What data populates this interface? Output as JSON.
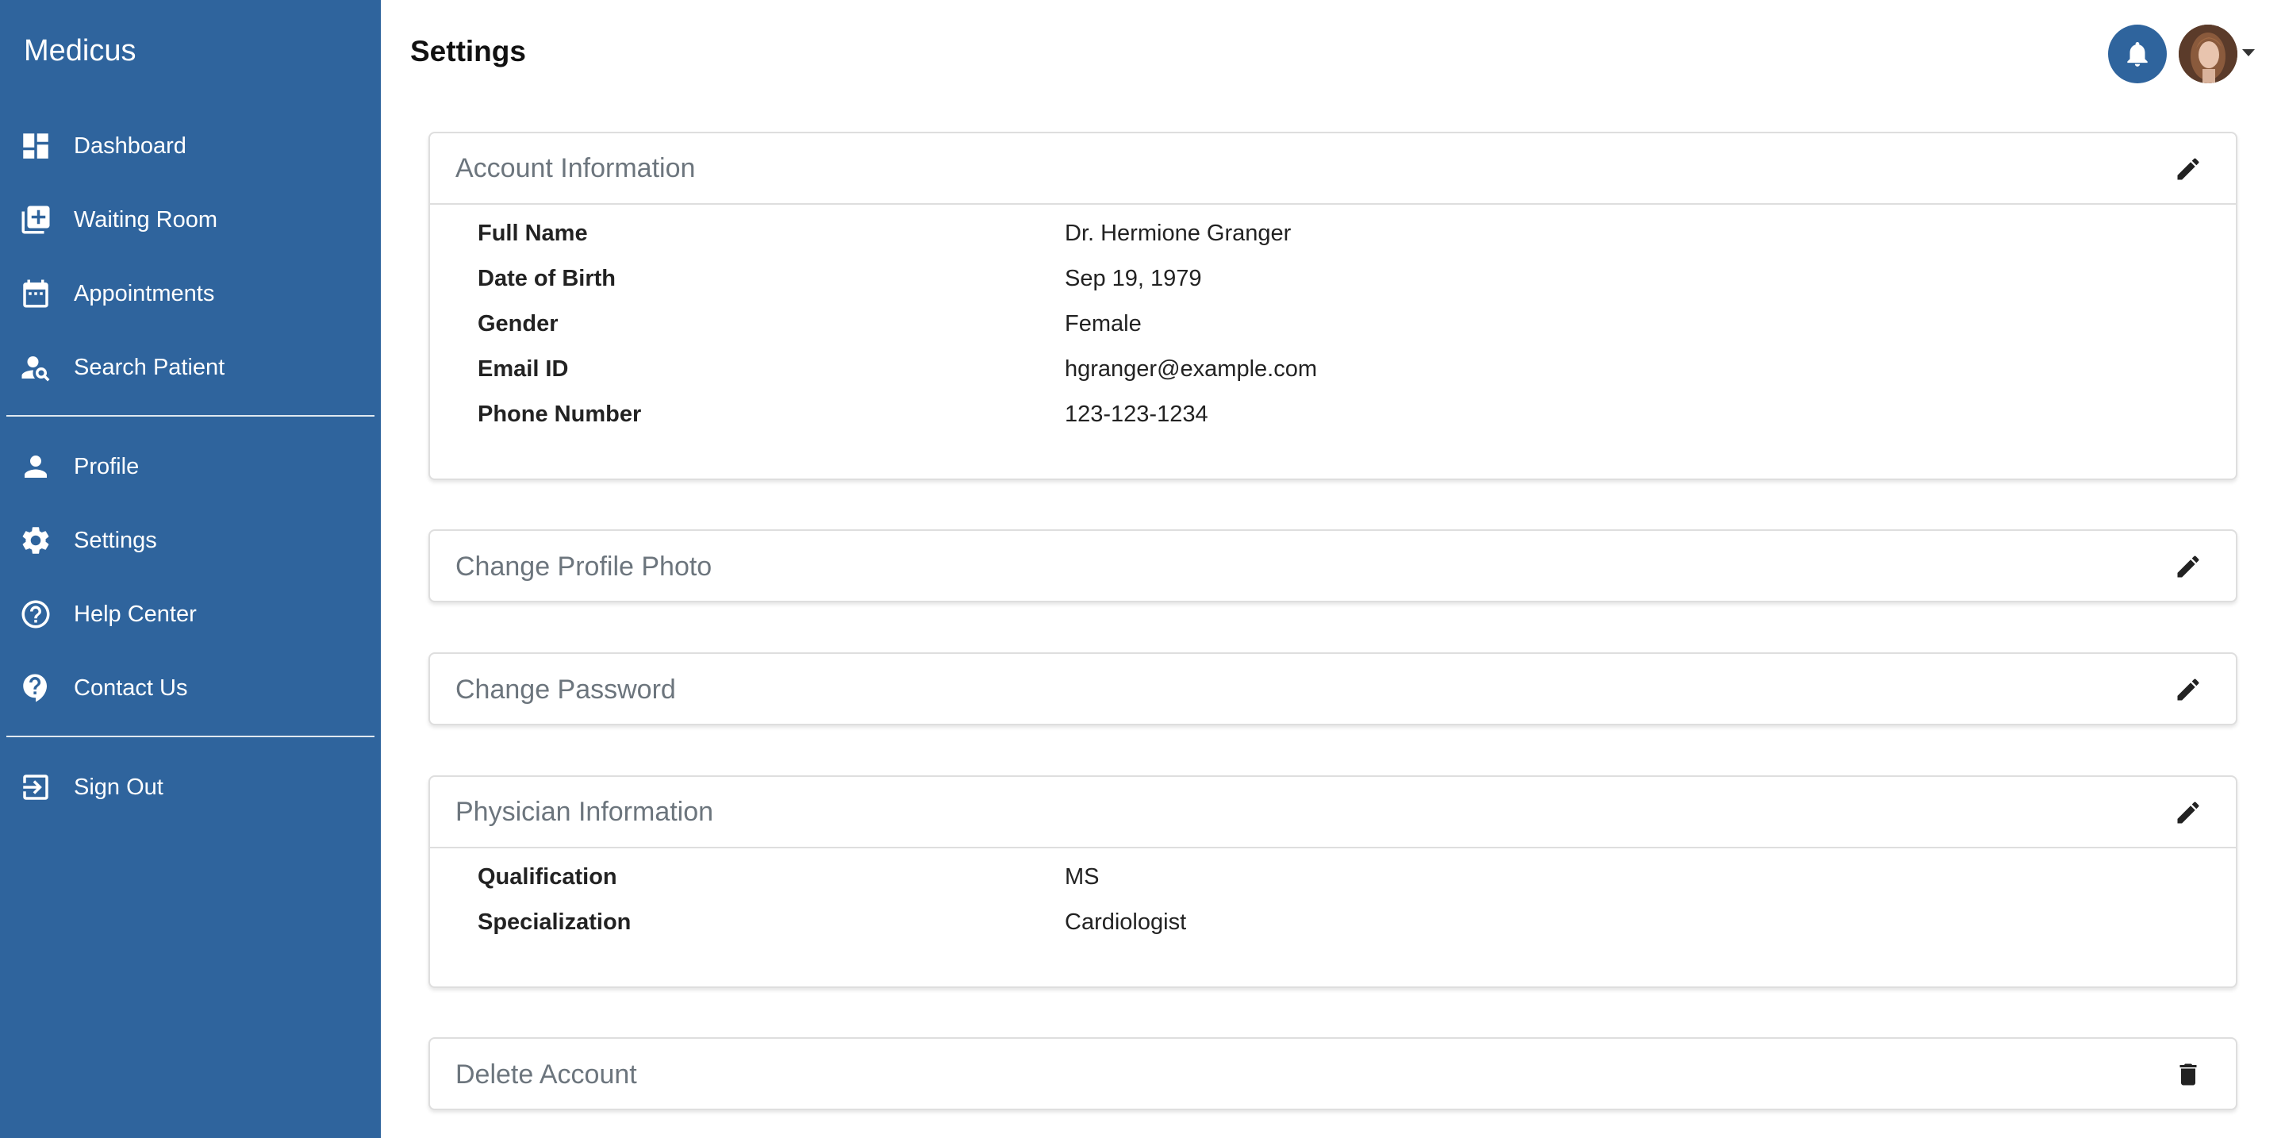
{
  "app": {
    "brand": "Medicus"
  },
  "sidebar": {
    "items": [
      {
        "label": "Dashboard",
        "icon": "dashboard-icon"
      },
      {
        "label": "Waiting Room",
        "icon": "add-to-queue-icon"
      },
      {
        "label": "Appointments",
        "icon": "calendar-icon"
      },
      {
        "label": "Search Patient",
        "icon": "person-search-icon"
      },
      {
        "label": "Profile",
        "icon": "person-icon"
      },
      {
        "label": "Settings",
        "icon": "gear-icon"
      },
      {
        "label": "Help Center",
        "icon": "help-circle-icon"
      },
      {
        "label": "Contact Us",
        "icon": "contact-support-icon"
      },
      {
        "label": "Sign Out",
        "icon": "logout-icon"
      }
    ]
  },
  "header": {
    "title": "Settings"
  },
  "account": {
    "title": "Account Information",
    "rows": [
      {
        "label": "Full Name",
        "value": "Dr. Hermione Granger"
      },
      {
        "label": "Date of Birth",
        "value": "Sep 19, 1979"
      },
      {
        "label": "Gender",
        "value": "Female"
      },
      {
        "label": "Email ID",
        "value": "hgranger@example.com"
      },
      {
        "label": "Phone Number",
        "value": "123-123-1234"
      }
    ]
  },
  "profile_photo": {
    "title": "Change Profile Photo"
  },
  "password": {
    "title": "Change Password"
  },
  "physician": {
    "title": "Physician Information",
    "rows": [
      {
        "label": "Qualification",
        "value": "MS"
      },
      {
        "label": "Specialization",
        "value": "Cardiologist"
      }
    ]
  },
  "delete_account": {
    "title": "Delete Account"
  },
  "colors": {
    "sidebar_bg": "#2f649d",
    "accent": "#2f649d",
    "card_title": "#6c757d"
  }
}
